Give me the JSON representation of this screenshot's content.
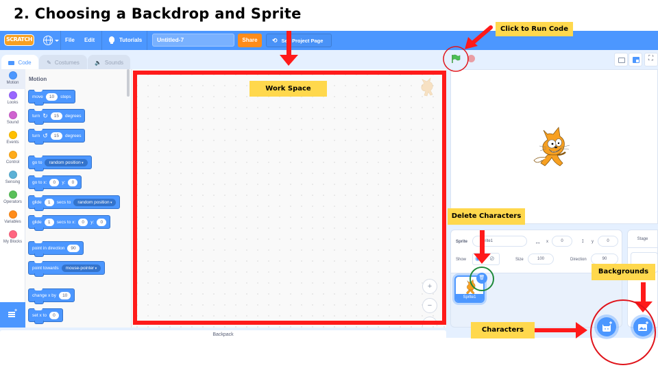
{
  "slide": {
    "title": "2. Choosing a Backdrop and Sprite"
  },
  "menubar": {
    "logo_text": "SCRATCH",
    "language_icon": "globe-icon",
    "file_label": "File",
    "edit_label": "Edit",
    "tutorials_label": "Tutorials",
    "project_title_value": "Untitled-7",
    "share_label": "Share",
    "see_project_page_label": "See Project Page"
  },
  "editor_tabs": [
    {
      "label": "Code",
      "icon": "code-icon",
      "active": true
    },
    {
      "label": "Costumes",
      "icon": "brush-icon",
      "active": false
    },
    {
      "label": "Sounds",
      "icon": "speaker-icon",
      "active": false
    }
  ],
  "categories": [
    {
      "label": "Motion",
      "color": "#4c97ff"
    },
    {
      "label": "Looks",
      "color": "#9966ff"
    },
    {
      "label": "Sound",
      "color": "#cf63cf"
    },
    {
      "label": "Events",
      "color": "#ffbf00"
    },
    {
      "label": "Control",
      "color": "#ffab19"
    },
    {
      "label": "Sensing",
      "color": "#5cb1d6"
    },
    {
      "label": "Operators",
      "color": "#59c059"
    },
    {
      "label": "Variables",
      "color": "#ff8c1a"
    },
    {
      "label": "My Blocks",
      "color": "#ff6680"
    }
  ],
  "palette": {
    "heading": "Motion",
    "blocks": {
      "move": {
        "pre": "move",
        "val": "10",
        "post": "steps"
      },
      "turn_right": {
        "pre": "turn",
        "icon": "↻",
        "val": "15",
        "post": "degrees"
      },
      "turn_left": {
        "pre": "turn",
        "icon": "↺",
        "val": "15",
        "post": "degrees"
      },
      "goto": {
        "pre": "go to",
        "dropdown": "random position"
      },
      "goto_xy": {
        "pre": "go to x:",
        "x": "0",
        "mid": "y:",
        "y": "0"
      },
      "glide": {
        "pre": "glide",
        "val": "1",
        "mid": "secs to",
        "dropdown": "random position"
      },
      "glide_xy": {
        "pre": "glide",
        "val": "1",
        "mid": "secs to x:",
        "x": "0",
        "mid2": "y:",
        "y": "0"
      },
      "point_dir": {
        "pre": "point in direction",
        "val": "90"
      },
      "point_towards": {
        "pre": "point towards",
        "dropdown": "mouse-pointer"
      },
      "change_x": {
        "pre": "change x by",
        "val": "10"
      },
      "set_x": {
        "pre": "set x to",
        "val": "0"
      }
    }
  },
  "workspace": {
    "zoom_in": "+",
    "zoom_out": "−"
  },
  "backpack": {
    "label": "Backpack"
  },
  "sprite_info": {
    "sprite_label": "Sprite",
    "sprite_name": "Sprite1",
    "x_label": "x",
    "x_value": "0",
    "y_label": "y",
    "y_value": "0",
    "show_label": "Show",
    "size_label": "Size",
    "size_value": "100",
    "direction_label": "Direction",
    "direction_value": "90"
  },
  "sprite_list": [
    {
      "name": "Sprite1",
      "selected": true
    }
  ],
  "stage_pane": {
    "label": "Stage"
  },
  "annotations": {
    "click_to_run": "Click to Run Code",
    "work_space": "Work Space",
    "delete_characters": "Delete Characters",
    "backgrounds": "Backgrounds",
    "characters": "Characters"
  },
  "colors": {
    "scratch_blue": "#4c97ff",
    "share_orange": "#ff8c1a",
    "annotation_red": "#ff1a1a",
    "annotation_yellow": "#ffd84d",
    "annotation_green": "#1e8a3a",
    "cat_orange": "#f7a021"
  }
}
